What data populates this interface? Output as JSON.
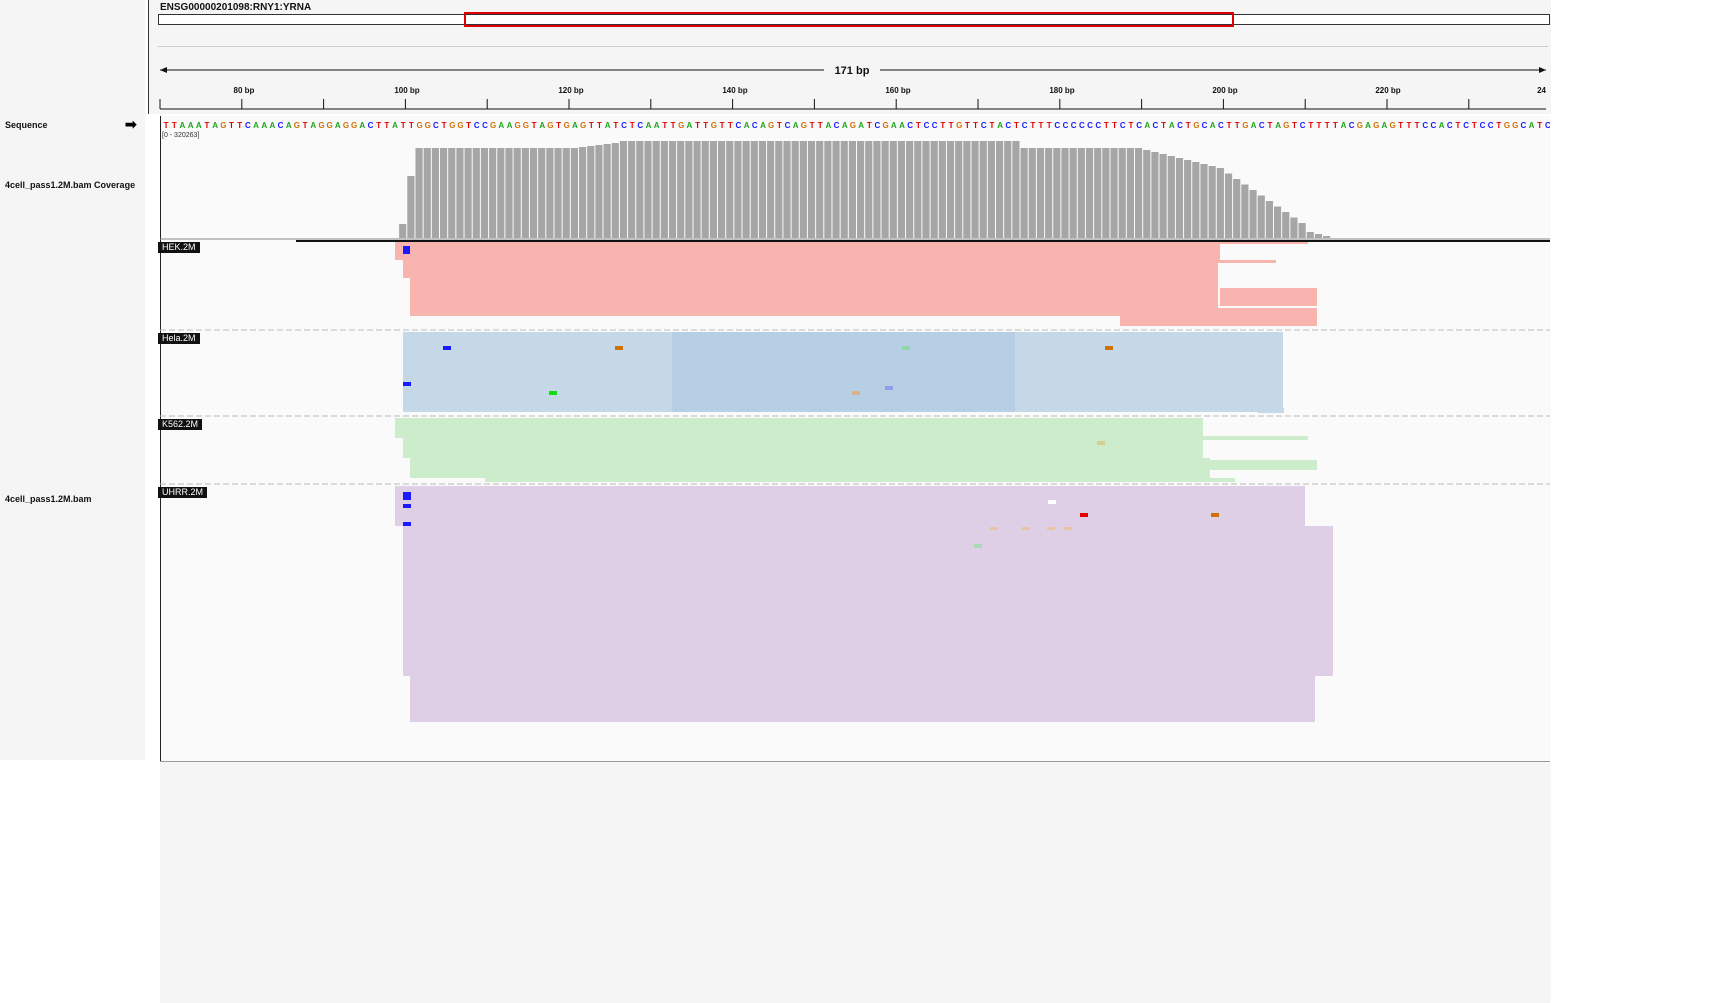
{
  "locus": {
    "gene_label": "ENSG00000201098:RNY1:YRNA"
  },
  "ruler": {
    "span_label": "171 bp",
    "ticks": [
      "80 bp",
      "100 bp",
      "120 bp",
      "140 bp",
      "160 bp",
      "180 bp",
      "200 bp",
      "220 bp",
      "24"
    ]
  },
  "tracks": {
    "sequence": {
      "name": "Sequence",
      "strand_icon": "right-arrow-icon",
      "bases": "TTAAATAGTTCAAACAGTAGGAGGACTTATTGGCTGGTCCGAAGGTAGTGAGTTATCTCAATTGATTGTTCACAGTCAGTTACAGATCGAACTCCTTGTTCTACTCTTTCCCCCCTTCTCACTACTGCACTTGACTAGTCTTTTACGAGAGTTTCCACTCTCCTGGCATCC"
    },
    "coverage": {
      "name": "4cell_pass1.2M.bam Coverage",
      "range": "[0 - 320263]"
    },
    "alignments": {
      "name": "4cell_pass1.2M.bam"
    }
  },
  "samples": [
    {
      "label": "HEK.2M",
      "color": "#f8b4ae"
    },
    {
      "label": "Hela.2M",
      "color": "#c4d8e8"
    },
    {
      "label": "K562.2M",
      "color": "#cdeccb"
    },
    {
      "label": "UHRR.2M",
      "color": "#dfcfe6"
    }
  ],
  "colors": {
    "A": "#1aa51a",
    "C": "#1a1aff",
    "G": "#d17105",
    "T": "#e00000",
    "coverage_bar": "#a6a6a6",
    "roi": "#e00000"
  }
}
